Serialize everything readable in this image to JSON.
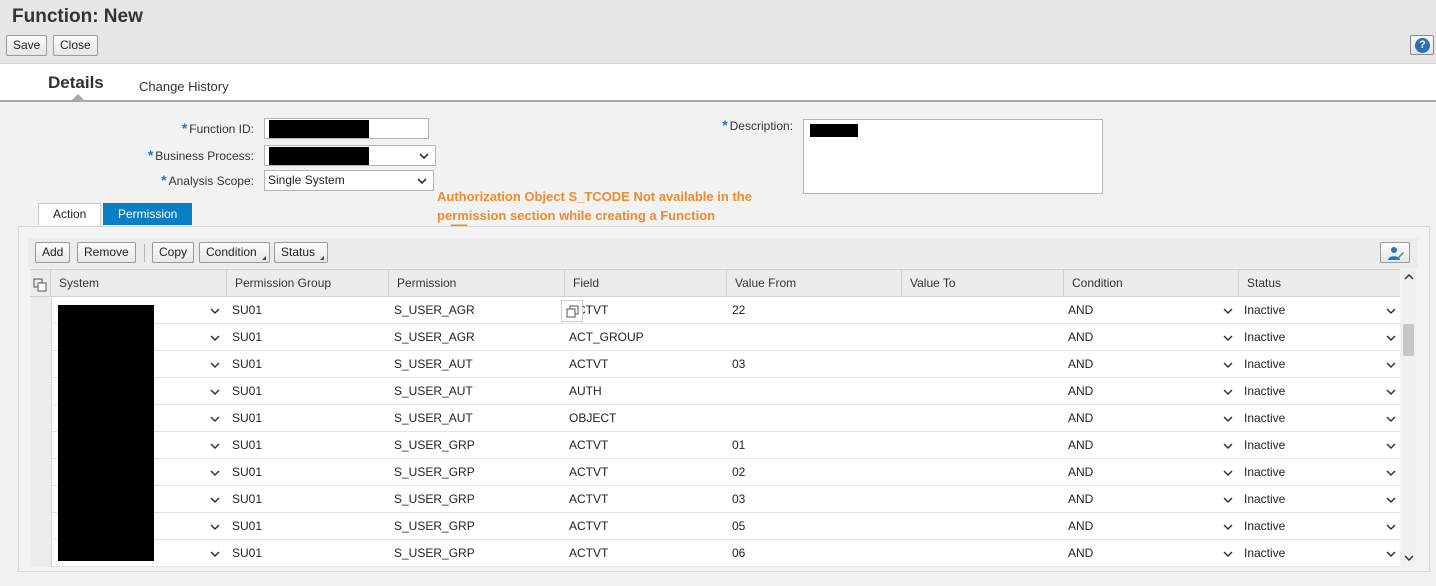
{
  "page": {
    "title": "Function: New"
  },
  "toolbar": {
    "save_label": "Save",
    "close_label": "Close",
    "help_label": "?"
  },
  "tabs": {
    "details": "Details",
    "change_history": "Change History"
  },
  "form": {
    "function_id_label": "Function ID:",
    "business_process_label": "Business Process:",
    "analysis_scope_label": "Analysis Scope:",
    "analysis_scope_value": "Single System",
    "description_label": "Description:",
    "required_mark": "*"
  },
  "subtabs": {
    "action": "Action",
    "permission": "Permission"
  },
  "grid_toolbar": {
    "add": "Add",
    "remove": "Remove",
    "copy": "Copy",
    "condition": "Condition",
    "status": "Status"
  },
  "annotation": {
    "line1": "Authorization Object S_TCODE Not available in the",
    "line2": "permission section while creating a Function",
    "color": "#f08a2e"
  },
  "columns": {
    "system": "System",
    "permission_group": "Permission Group",
    "permission": "Permission",
    "field": "Field",
    "value_from": "Value From",
    "value_to": "Value To",
    "condition": "Condition",
    "status": "Status"
  },
  "rows": [
    {
      "group": "SU01",
      "permission": "S_USER_AGR",
      "field": "ACTVT",
      "value_from": "22",
      "value_to": "",
      "condition": "AND",
      "status": "Inactive"
    },
    {
      "group": "SU01",
      "permission": "S_USER_AGR",
      "field": "ACT_GROUP",
      "value_from": "",
      "value_to": "",
      "condition": "AND",
      "status": "Inactive"
    },
    {
      "group": "SU01",
      "permission": "S_USER_AUT",
      "field": "ACTVT",
      "value_from": "03",
      "value_to": "",
      "condition": "AND",
      "status": "Inactive"
    },
    {
      "group": "SU01",
      "permission": "S_USER_AUT",
      "field": "AUTH",
      "value_from": "",
      "value_to": "",
      "condition": "AND",
      "status": "Inactive"
    },
    {
      "group": "SU01",
      "permission": "S_USER_AUT",
      "field": "OBJECT",
      "value_from": "",
      "value_to": "",
      "condition": "AND",
      "status": "Inactive"
    },
    {
      "group": "SU01",
      "permission": "S_USER_GRP",
      "field": "ACTVT",
      "value_from": "01",
      "value_to": "",
      "condition": "AND",
      "status": "Inactive"
    },
    {
      "group": "SU01",
      "permission": "S_USER_GRP",
      "field": "ACTVT",
      "value_from": "02",
      "value_to": "",
      "condition": "AND",
      "status": "Inactive"
    },
    {
      "group": "SU01",
      "permission": "S_USER_GRP",
      "field": "ACTVT",
      "value_from": "03",
      "value_to": "",
      "condition": "AND",
      "status": "Inactive"
    },
    {
      "group": "SU01",
      "permission": "S_USER_GRP",
      "field": "ACTVT",
      "value_from": "05",
      "value_to": "",
      "condition": "AND",
      "status": "Inactive"
    },
    {
      "group": "SU01",
      "permission": "S_USER_GRP",
      "field": "ACTVT",
      "value_from": "06",
      "value_to": "",
      "condition": "AND",
      "status": "Inactive"
    }
  ],
  "colors": {
    "accent": "#0a7ec2",
    "required": "#1a75cf"
  }
}
